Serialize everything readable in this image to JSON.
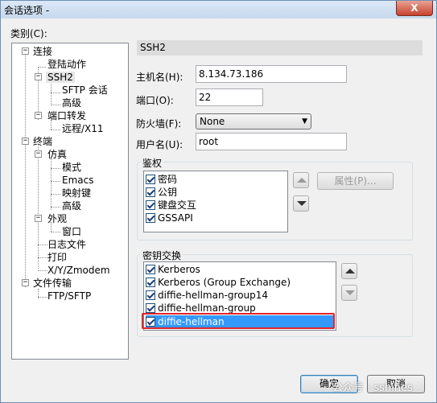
{
  "window": {
    "title": "会话选项 -",
    "close_label": "X"
  },
  "category_label": "类别(C):",
  "tree": {
    "items": [
      {
        "label": "连接",
        "expander": "−"
      },
      {
        "label": "登陆动作"
      },
      {
        "label": "SSH2",
        "expander": "−",
        "selected": true
      },
      {
        "label": "SFTP 会话"
      },
      {
        "label": "高级"
      },
      {
        "label": "端口转发",
        "expander": "−"
      },
      {
        "label": "远程/X11"
      },
      {
        "label": "终端",
        "expander": "−"
      },
      {
        "label": "仿真",
        "expander": "−"
      },
      {
        "label": "模式"
      },
      {
        "label": "Emacs"
      },
      {
        "label": "映射键"
      },
      {
        "label": "高级"
      },
      {
        "label": "外观",
        "expander": "−"
      },
      {
        "label": "窗口"
      },
      {
        "label": "日志文件"
      },
      {
        "label": "打印"
      },
      {
        "label": "X/Y/Zmodem"
      },
      {
        "label": "文件传输",
        "expander": "−"
      },
      {
        "label": "FTP/SFTP"
      }
    ]
  },
  "panel": {
    "header": "SSH2",
    "hostname_label": "主机名(H):",
    "hostname_value": "8.134.73.186",
    "port_label": "端口(O):",
    "port_value": "22",
    "firewall_label": "防火墙(F):",
    "firewall_value": "None",
    "username_label": "用户名(U):",
    "username_value": "root"
  },
  "auth": {
    "title": "鉴权",
    "items": [
      "密码",
      "公钥",
      "键盘交互",
      "GSSAPI"
    ],
    "properties_button": "属性(P)..."
  },
  "kex": {
    "title": "密钥交换",
    "items": [
      "Kerberos",
      "Kerberos (Group Exchange)",
      "diffie-hellman-group14",
      "diffie-hellman-group",
      "diffie-hellman"
    ],
    "selected_index": 4
  },
  "buttons": {
    "ok": "确定",
    "cancel": "取消"
  },
  "watermark": "公众号 · sshines",
  "colors": {
    "selection": "#3399ff",
    "highlight_border": "#e4232a"
  }
}
